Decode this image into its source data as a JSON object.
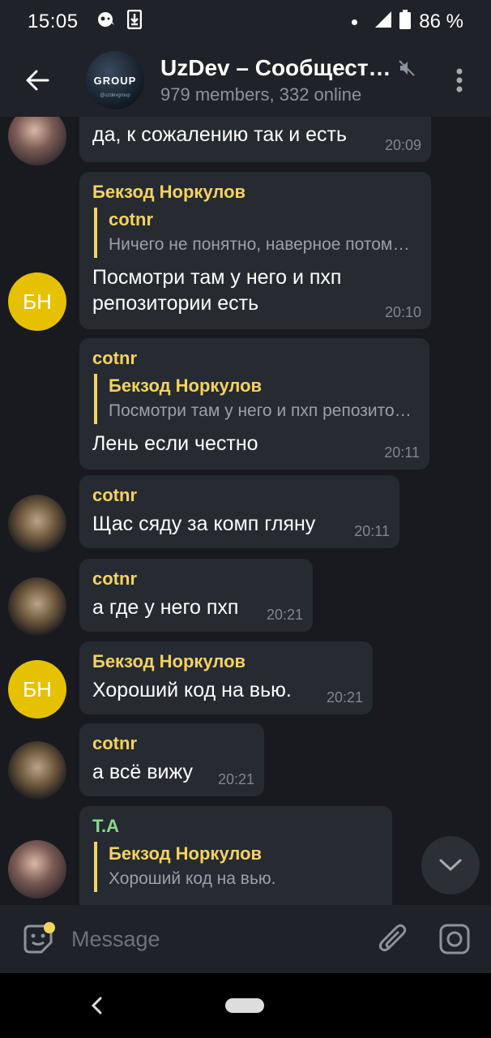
{
  "status_bar": {
    "time": "15:05",
    "battery": "86 %"
  },
  "header": {
    "title": "UzDev – Сообщест…",
    "subtitle": "979 members, 332 online",
    "avatar_text": "GROUP",
    "avatar_subtext": "@uzdevgroup"
  },
  "messages": [
    {
      "text": "да, к сожалению так и есть",
      "time": "20:09"
    },
    {
      "sender": "Бекзод Норкулов",
      "reply_name": "cotnr",
      "reply_text": "Ничего не понятно, наверное потому что…",
      "text": "Посмотри там у него и пхп репозитории есть",
      "time": "20:10",
      "avatar_initials": "БН"
    },
    {
      "sender": "cotnr",
      "reply_name": "Бекзод Норкулов",
      "reply_text": "Посмотри там у него и пхп репозитории есть",
      "text": "Лень если честно",
      "time": "20:11"
    },
    {
      "sender": "cotnr",
      "text": "Щас сяду за комп гляну",
      "time": "20:11"
    },
    {
      "sender": "cotnr",
      "text": "а где у него пхп",
      "time": "20:21"
    },
    {
      "sender": "Бекзод Норкулов",
      "text": "Хороший код на вью.",
      "time": "20:21",
      "avatar_initials": "БН"
    },
    {
      "sender": "cotnr",
      "text": "а всё вижу",
      "time": "20:21"
    },
    {
      "sender": "T.A",
      "reply_name": "Бекзод Норкулов",
      "reply_text": "Хороший код на вью."
    }
  ],
  "input": {
    "placeholder": "Message"
  },
  "colors": {
    "accent_yellow": "#f4d35e",
    "sender_green": "#8bd98b",
    "bubble_bg": "#262a31",
    "chat_bg": "#181a1f",
    "initials_avatar": "#e5c100"
  }
}
